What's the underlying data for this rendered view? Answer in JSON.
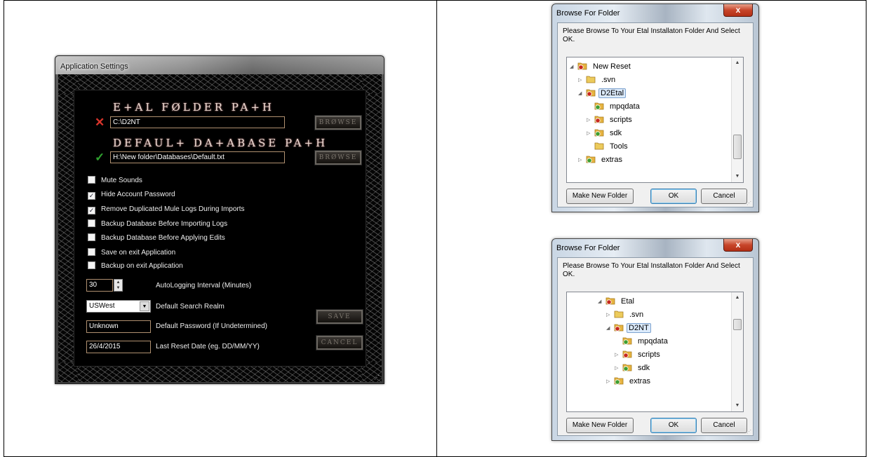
{
  "app_settings": {
    "window_title": "Application Settings",
    "etal_heading": "E+AL FØLDER PA+H",
    "etal_path": "C:\\D2NT",
    "db_heading": "DEFAUL+ DA+ABASE PA+H",
    "db_path": "H:\\New folder\\Databases\\Default.txt",
    "browse_label": "BRØWSE",
    "save_label": "SAVE",
    "cancel_label": "CANCEL",
    "checkboxes": [
      {
        "label": "Mute Sounds",
        "checked": false
      },
      {
        "label": "Hide Account Password",
        "checked": true
      },
      {
        "label": "Remove Duplicated Mule Logs During Imports",
        "checked": true
      },
      {
        "label": "Backup Database Before Importing Logs",
        "checked": false
      },
      {
        "label": "Backup Database Before Applying Edits",
        "checked": false
      },
      {
        "label": "Save on exit Application",
        "checked": false
      },
      {
        "label": "Backup on exit Application",
        "checked": false
      }
    ],
    "autolog_value": "30",
    "autolog_label": "AutoLogging Interval (Minutes)",
    "realm_value": "USWest",
    "realm_label": "Default Search Realm",
    "password_value": "Unknown",
    "password_label": "Default Password (If Undetermined)",
    "reset_value": "26/4/2015",
    "reset_label": "Last Reset Date (eg. DD/MM/YY)",
    "etal_status_icon": "x-mark-icon",
    "db_status_icon": "check-mark-icon",
    "colors": {
      "invalid": "#d9342b",
      "valid": "#2fa12f",
      "field_border": "#b09070"
    }
  },
  "browse_dialog_1": {
    "title": "Browse For Folder",
    "description": "Please Browse To Your Etal Installaton Folder And Select OK.",
    "tree": [
      {
        "label": "New Reset",
        "icon": "red-folder-icon",
        "expander": "◢",
        "indent": 0,
        "selected": false
      },
      {
        "label": ".svn",
        "icon": "yellow-folder-icon",
        "expander": "▷",
        "indent": 1,
        "selected": false
      },
      {
        "label": "D2Etal",
        "icon": "red-folder-icon",
        "expander": "◢",
        "indent": 1,
        "selected": true
      },
      {
        "label": "mpqdata",
        "icon": "green-folder-icon",
        "expander": "",
        "indent": 2,
        "selected": false
      },
      {
        "label": "scripts",
        "icon": "red-folder-icon",
        "expander": "▷",
        "indent": 2,
        "selected": false
      },
      {
        "label": "sdk",
        "icon": "green-folder-icon",
        "expander": "▷",
        "indent": 2,
        "selected": false
      },
      {
        "label": "Tools",
        "icon": "yellow-folder-icon",
        "expander": "",
        "indent": 2,
        "selected": false
      },
      {
        "label": "extras",
        "icon": "green-folder-icon",
        "expander": "▷",
        "indent": 1,
        "selected": false
      }
    ],
    "make_new_folder": "Make New Folder",
    "ok": "OK",
    "cancel": "Cancel",
    "close": "x"
  },
  "browse_dialog_2": {
    "title": "Browse For Folder",
    "description": "Please Browse To Your Etal Installaton Folder And Select OK.",
    "tree": [
      {
        "label": "Etal",
        "icon": "red-folder-icon",
        "expander": "◢",
        "indent": 0,
        "selected": false
      },
      {
        "label": ".svn",
        "icon": "yellow-folder-icon",
        "expander": "▷",
        "indent": 1,
        "selected": false
      },
      {
        "label": "D2NT",
        "icon": "red-folder-icon",
        "expander": "◢",
        "indent": 1,
        "selected": true
      },
      {
        "label": "mpqdata",
        "icon": "green-folder-icon",
        "expander": "",
        "indent": 2,
        "selected": false
      },
      {
        "label": "scripts",
        "icon": "red-folder-icon",
        "expander": "▷",
        "indent": 2,
        "selected": false
      },
      {
        "label": "sdk",
        "icon": "green-folder-icon",
        "expander": "▷",
        "indent": 2,
        "selected": false
      },
      {
        "label": "extras",
        "icon": "green-folder-icon",
        "expander": "▷",
        "indent": 1,
        "selected": false
      }
    ],
    "make_new_folder": "Make New Folder",
    "ok": "OK",
    "cancel": "Cancel",
    "close": "x"
  }
}
